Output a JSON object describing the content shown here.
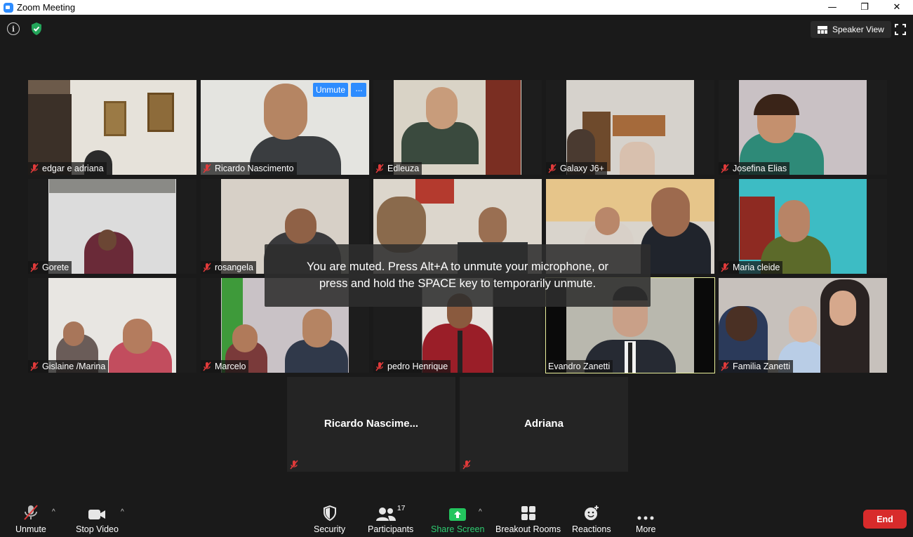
{
  "window": {
    "title": "Zoom Meeting"
  },
  "top_bar": {
    "view_button_label": "Speaker View"
  },
  "tiles": [
    {
      "name": "edgar e adriana"
    },
    {
      "name": "Ricardo Nascimento",
      "unmute_label": "Unmute",
      "more_label": "···"
    },
    {
      "name": "Edleuza"
    },
    {
      "name": "Galaxy J6+"
    },
    {
      "name": "Josefina Elias"
    },
    {
      "name": "Gorete"
    },
    {
      "name": "rosangela"
    },
    {
      "name": ""
    },
    {
      "name": ""
    },
    {
      "name": "Maria cleide"
    },
    {
      "name": "Gislaine /Marina"
    },
    {
      "name": "Marcelo"
    },
    {
      "name": "pedro Henrique"
    },
    {
      "name": "Evandro Zanetti",
      "active_speaker": true
    },
    {
      "name": "Familia Zanetti"
    }
  ],
  "name_tiles": [
    {
      "name": "Ricardo  Nascime..."
    },
    {
      "name": "Adriana"
    }
  ],
  "toast": {
    "line1": "You are muted. Press Alt+A to unmute your microphone, or",
    "line2": "press and hold the SPACE key to temporarily unmute."
  },
  "toolbar": {
    "unmute": "Unmute",
    "stop_video": "Stop Video",
    "security": "Security",
    "participants": "Participants",
    "participant_count": "17",
    "share_screen": "Share Screen",
    "breakout_rooms": "Breakout Rooms",
    "reactions": "Reactions",
    "more": "More",
    "end": "End"
  },
  "colors": {
    "background": "#1a1a1a",
    "accent_blue": "#2d8cff",
    "active_speaker_border": "#e9ef9a",
    "share_green": "#2ecc71",
    "end_red": "#d82b2b",
    "muted_red": "#e03a3a"
  }
}
